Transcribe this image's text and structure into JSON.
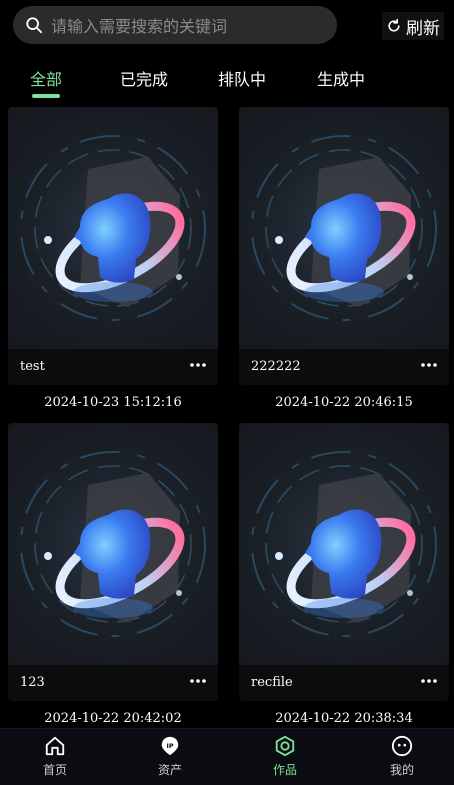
{
  "search": {
    "placeholder": "请输入需要搜索的关键词",
    "icon": "search-icon"
  },
  "refresh": {
    "label": "刷新",
    "icon": "refresh-icon"
  },
  "tabs": [
    {
      "label": "全部",
      "active": true
    },
    {
      "label": "已完成",
      "active": false
    },
    {
      "label": "排队中",
      "active": false
    },
    {
      "label": "生成中",
      "active": false
    }
  ],
  "accent_color": "#7de19a",
  "cards": [
    {
      "title": "test",
      "date": "2024-10-23 15:12:16"
    },
    {
      "title": "222222",
      "date": "2024-10-22 20:46:15"
    },
    {
      "title": "123",
      "date": "2024-10-22 20:42:02"
    },
    {
      "title": "recfile",
      "date": "2024-10-22 20:38:34"
    }
  ],
  "bottom_nav": [
    {
      "label": "首页",
      "icon": "home-icon",
      "active": false
    },
    {
      "label": "资产",
      "icon": "ip-assets-icon",
      "active": false
    },
    {
      "label": "作品",
      "icon": "works-icon",
      "active": true
    },
    {
      "label": "我的",
      "icon": "profile-icon",
      "active": false
    }
  ]
}
